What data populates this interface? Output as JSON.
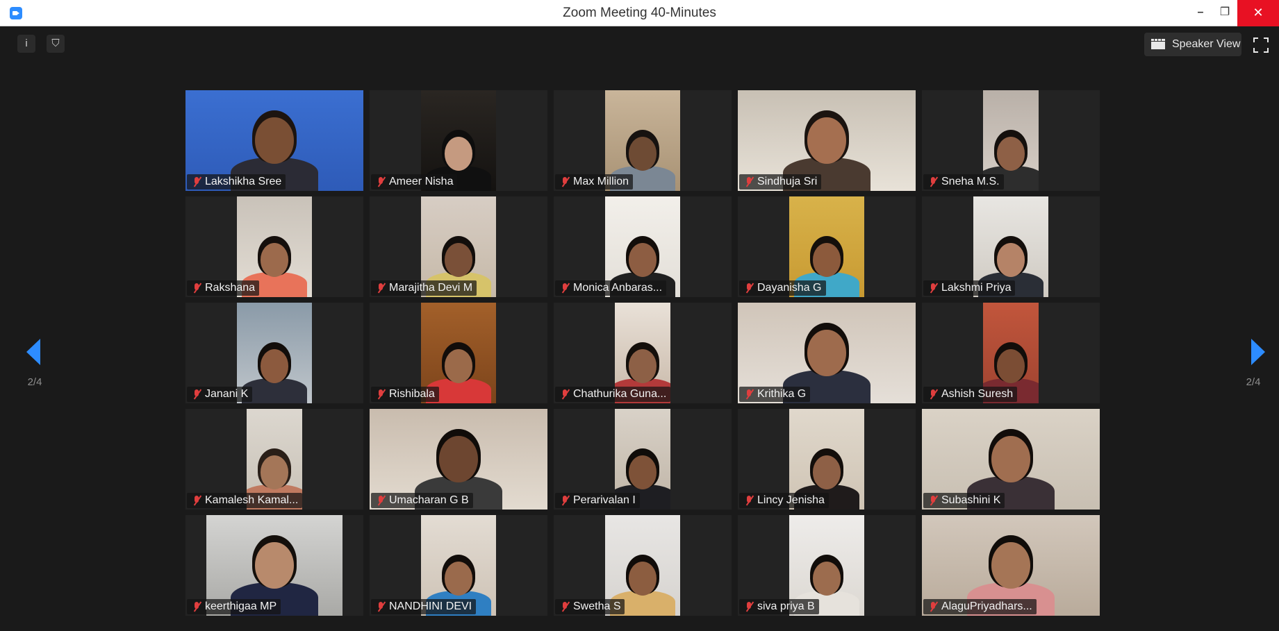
{
  "window": {
    "title": "Zoom Meeting 40-Minutes",
    "minimize": "–",
    "restore": "❐",
    "close": "✕"
  },
  "toolbar": {
    "speaker_view_label": "Speaker View",
    "info_glyph": "i",
    "shield_glyph": "⛉"
  },
  "pagination": {
    "left_label": "2/4",
    "right_label": "2/4"
  },
  "colors": {
    "accent": "#2d8cff",
    "muted_mic": "#e03e3e",
    "close_red": "#e81123"
  },
  "participants": [
    {
      "name": "Lakshikha Sree",
      "muted": true
    },
    {
      "name": "Ameer Nisha",
      "muted": true
    },
    {
      "name": "Max Million",
      "muted": true
    },
    {
      "name": "Sindhuja Sri",
      "muted": true
    },
    {
      "name": "Sneha M.S.",
      "muted": true
    },
    {
      "name": "Rakshana",
      "muted": true
    },
    {
      "name": "Marajitha Devi M",
      "muted": true
    },
    {
      "name": "Monica Anbaras...",
      "muted": true
    },
    {
      "name": "Dayanisha G",
      "muted": true
    },
    {
      "name": "Lakshmi Priya",
      "muted": true
    },
    {
      "name": "Janani K",
      "muted": true
    },
    {
      "name": "Rishibala",
      "muted": true
    },
    {
      "name": "Chathurika Guna...",
      "muted": true
    },
    {
      "name": "Krithika G",
      "muted": true
    },
    {
      "name": "Ashish Suresh",
      "muted": true
    },
    {
      "name": "Kamalesh Kamal...",
      "muted": true
    },
    {
      "name": "Umacharan G B",
      "muted": true
    },
    {
      "name": "Perarivalan I",
      "muted": true
    },
    {
      "name": "Lincy Jenisha",
      "muted": true
    },
    {
      "name": "Subashini K",
      "muted": true
    },
    {
      "name": "keerthigaa MP",
      "muted": true
    },
    {
      "name": "NANDHINI DEVI",
      "muted": true
    },
    {
      "name": "Swetha S",
      "muted": true
    },
    {
      "name": "siva priya B",
      "muted": true
    },
    {
      "name": "AlaguPriyadhars...",
      "muted": true
    }
  ]
}
